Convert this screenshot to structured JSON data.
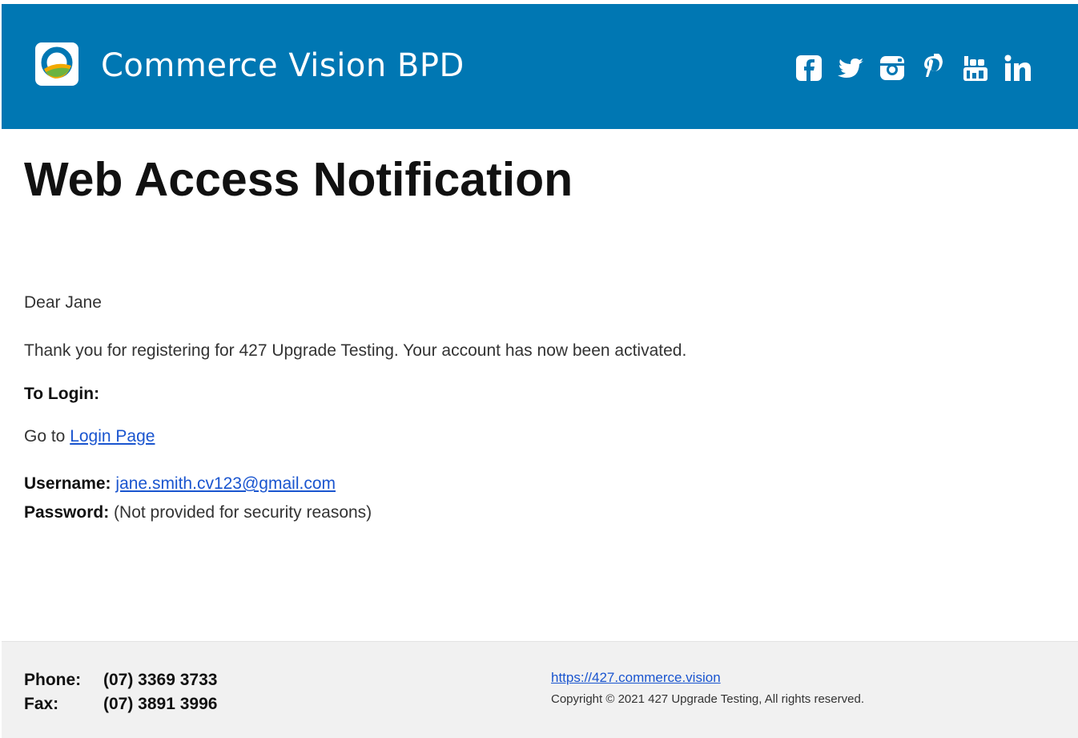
{
  "header": {
    "brand": "Commerce Vision BPD",
    "background": "#0077b3",
    "social_icons": [
      "facebook-icon",
      "twitter-icon",
      "instagram-icon",
      "pinterest-icon",
      "youtube-icon",
      "linkedin-icon"
    ]
  },
  "title": "Web Access Notification",
  "body": {
    "greeting": "Dear Jane",
    "message": "Thank you for registering for 427 Upgrade Testing. Your account has now been activated.",
    "login_heading": "To Login:",
    "goto_prefix": "Go to ",
    "login_link": "Login Page",
    "username_label": "Username:",
    "username_value": "jane.smith.cv123@gmail.com",
    "password_label": "Password:",
    "password_value": "(Not provided for security reasons)"
  },
  "footer": {
    "phone_label": "Phone:",
    "phone_value": "(07) 3369 3733",
    "fax_label": "Fax:",
    "fax_value": "(07) 3891 3996",
    "website": "https://427.commerce.vision",
    "copyright": "Copyright © 2021 427 Upgrade Testing, All rights reserved."
  }
}
